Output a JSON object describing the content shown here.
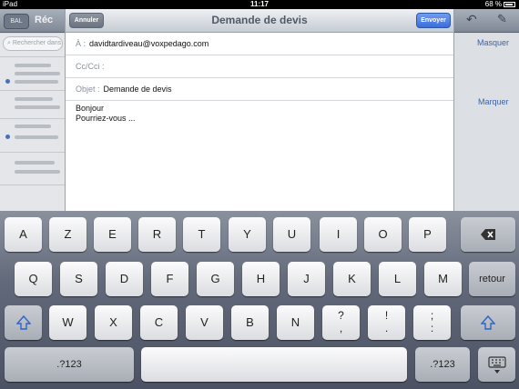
{
  "status": {
    "carrier": "iPad",
    "time": "11:17",
    "battery": "68 %"
  },
  "background": {
    "back_label": "BAL",
    "title": "Réc",
    "search_placeholder": "Rechercher dans",
    "hide_link": "Masquer",
    "mark_link": "Marquer"
  },
  "compose": {
    "cancel_label": "Annuler",
    "title": "Demande de devis",
    "send_label": "Envoyer",
    "to_label": "À :",
    "to_value": "davidtardiveau@voxpedago.com",
    "cc_label": "Cc/Cci :",
    "cc_value": "",
    "subject_label": "Objet :",
    "subject_value": "Demande de devis",
    "body_line1": "Bonjour",
    "body_line2": "Pourriez-vous ..."
  },
  "keyboard": {
    "row1": [
      "A",
      "Z",
      "E",
      "R",
      "T",
      "Y",
      "U",
      "I",
      "O",
      "P"
    ],
    "row2": [
      "Q",
      "S",
      "D",
      "F",
      "G",
      "H",
      "J",
      "K",
      "L",
      "M"
    ],
    "return_label": "retour",
    "row3": [
      "W",
      "X",
      "C",
      "V",
      "B",
      "N"
    ],
    "row3_punct": [
      {
        "top": "?",
        "bottom": ","
      },
      {
        "top": "!",
        "bottom": "."
      },
      {
        "top": ";",
        "bottom": ":"
      }
    ],
    "numbers_label": ".?123",
    "icons": {
      "delete": "delete-icon",
      "shift": "shift-icon",
      "hide_keyboard": "keyboard-hide-icon"
    }
  }
}
